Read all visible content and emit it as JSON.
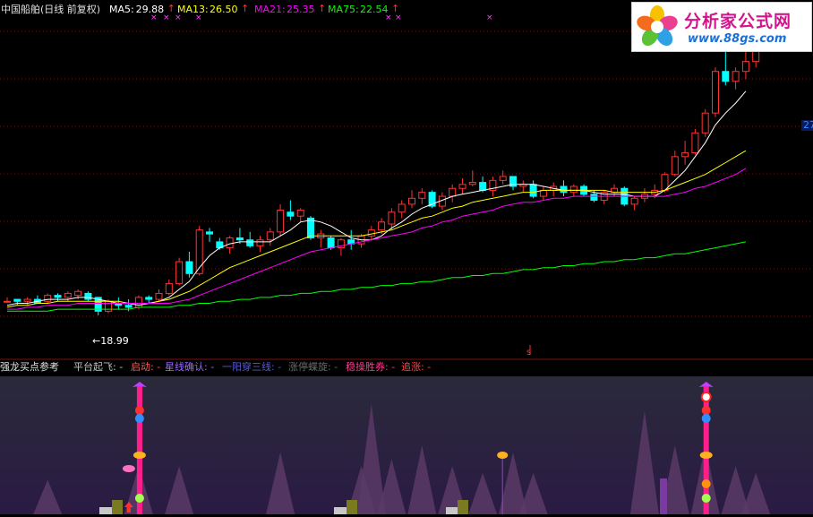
{
  "header": {
    "stock_name": "中国船舶(日线 前复权)",
    "ma": [
      {
        "label": "MA5:",
        "value": "29.88",
        "color": "#ffffff"
      },
      {
        "label": "MA13:",
        "value": "26.50",
        "color": "#ffff00"
      },
      {
        "label": "MA21:",
        "value": "25.35",
        "color": "#ff00ff"
      },
      {
        "label": "MA75:",
        "value": "22.54",
        "color": "#00ff00"
      }
    ],
    "arrow": "↑",
    "right_axis_label": "27",
    "low_marker": "18.99",
    "s_marker": "s"
  },
  "logo": {
    "title": "分析家公式网",
    "url": "www.88gs.com"
  },
  "indicator": {
    "title": "强龙买点参考",
    "signals": [
      {
        "label": "平台起飞:",
        "value": "-",
        "color": "#c0c0c0"
      },
      {
        "label": "启动:",
        "value": "-",
        "color": "#ff5a5a"
      },
      {
        "label": "星线确认:",
        "value": "-",
        "color": "#9a6bff"
      },
      {
        "label": "一阳穿三线:",
        "value": "-",
        "color": "#5a5ac8"
      },
      {
        "label": "涨停蝶旋:",
        "value": "-",
        "color": "#6a6a6a"
      },
      {
        "label": "稳操胜券:",
        "value": "-",
        "color": "#ff3c8c"
      },
      {
        "label": "追涨:",
        "value": "-",
        "color": "#ff4040"
      }
    ]
  },
  "colors": {
    "up": "#ff3232",
    "down": "#00ffff",
    "ma5": "#ffffff",
    "ma13": "#ffff00",
    "ma21": "#ff00ff",
    "ma75": "#00ff00",
    "grid": "#7a1010",
    "signal_bar": "#ff1e8c"
  },
  "chart_data": {
    "type": "candlestick",
    "title": "中国船舶(日线 前复权)",
    "ylim": [
      17.0,
      34.0
    ],
    "candles": [
      [
        19.7,
        19.9,
        19.6,
        19.7
      ],
      [
        19.8,
        19.8,
        19.5,
        19.7
      ],
      [
        19.7,
        19.9,
        19.5,
        19.8
      ],
      [
        19.8,
        20.0,
        19.6,
        19.6
      ],
      [
        19.7,
        20.1,
        19.6,
        20.0
      ],
      [
        20.0,
        20.1,
        19.7,
        19.9
      ],
      [
        19.9,
        20.2,
        19.7,
        20.1
      ],
      [
        20.0,
        20.3,
        19.8,
        20.2
      ],
      [
        20.1,
        20.2,
        19.7,
        19.8
      ],
      [
        19.9,
        19.9,
        18.99,
        19.2
      ],
      [
        19.2,
        19.8,
        19.1,
        19.7
      ],
      [
        19.6,
        19.9,
        19.3,
        19.5
      ],
      [
        19.5,
        19.8,
        19.2,
        19.4
      ],
      [
        19.4,
        20.0,
        19.3,
        19.9
      ],
      [
        19.9,
        20.0,
        19.6,
        19.8
      ],
      [
        19.8,
        20.3,
        19.7,
        20.1
      ],
      [
        20.1,
        20.8,
        20.0,
        20.6
      ],
      [
        20.6,
        21.9,
        20.5,
        21.7
      ],
      [
        21.7,
        22.2,
        20.9,
        21.1
      ],
      [
        21.1,
        23.5,
        21.0,
        23.3
      ],
      [
        23.2,
        23.4,
        22.7,
        23.1
      ],
      [
        22.7,
        22.9,
        22.3,
        22.4
      ],
      [
        22.4,
        23.0,
        22.1,
        22.9
      ],
      [
        22.9,
        23.4,
        22.6,
        22.8
      ],
      [
        22.8,
        23.2,
        22.4,
        22.5
      ],
      [
        22.5,
        23.0,
        22.2,
        22.8
      ],
      [
        22.8,
        23.4,
        22.5,
        23.2
      ],
      [
        23.2,
        24.6,
        23.0,
        24.3
      ],
      [
        24.2,
        24.8,
        23.8,
        24.0
      ],
      [
        24.0,
        24.4,
        23.7,
        24.3
      ],
      [
        23.9,
        24.0,
        22.8,
        22.9
      ],
      [
        22.9,
        23.3,
        22.4,
        23.1
      ],
      [
        22.9,
        23.0,
        22.3,
        22.4
      ],
      [
        22.4,
        22.9,
        22.0,
        22.8
      ],
      [
        22.8,
        23.3,
        22.3,
        22.6
      ],
      [
        22.6,
        23.1,
        22.4,
        23.0
      ],
      [
        23.0,
        23.5,
        22.8,
        23.3
      ],
      [
        23.3,
        23.9,
        23.1,
        23.7
      ],
      [
        23.6,
        24.4,
        23.3,
        24.2
      ],
      [
        24.2,
        24.8,
        23.9,
        24.6
      ],
      [
        24.6,
        25.3,
        24.4,
        24.9
      ],
      [
        24.9,
        25.4,
        24.6,
        25.2
      ],
      [
        25.2,
        25.3,
        24.4,
        24.5
      ],
      [
        24.5,
        25.2,
        24.3,
        25.0
      ],
      [
        25.0,
        25.6,
        24.7,
        25.4
      ],
      [
        25.4,
        25.9,
        25.1,
        25.6
      ],
      [
        25.6,
        26.3,
        25.5,
        25.7
      ],
      [
        25.7,
        26.0,
        25.2,
        25.3
      ],
      [
        25.3,
        26.0,
        25.0,
        25.8
      ],
      [
        25.8,
        26.3,
        25.6,
        26.0
      ],
      [
        26.0,
        26.0,
        25.3,
        25.5
      ],
      [
        25.5,
        25.8,
        25.2,
        25.6
      ],
      [
        25.6,
        25.8,
        24.9,
        25.0
      ],
      [
        25.0,
        25.5,
        24.8,
        25.3
      ],
      [
        25.3,
        25.7,
        25.0,
        25.5
      ],
      [
        25.5,
        25.8,
        25.0,
        25.2
      ],
      [
        25.2,
        25.6,
        25.0,
        25.5
      ],
      [
        25.5,
        25.6,
        25.0,
        25.1
      ],
      [
        25.1,
        25.3,
        24.7,
        24.8
      ],
      [
        24.8,
        25.3,
        24.6,
        25.2
      ],
      [
        25.2,
        25.6,
        25.0,
        25.4
      ],
      [
        25.4,
        25.5,
        24.5,
        24.6
      ],
      [
        24.6,
        25.0,
        24.3,
        24.9
      ],
      [
        24.9,
        25.4,
        24.7,
        25.1
      ],
      [
        25.1,
        25.6,
        24.9,
        25.3
      ],
      [
        25.3,
        26.2,
        25.2,
        26.1
      ],
      [
        26.1,
        27.3,
        26.0,
        27.0
      ],
      [
        27.0,
        27.8,
        26.6,
        27.2
      ],
      [
        27.2,
        28.4,
        27.1,
        28.2
      ],
      [
        28.2,
        29.4,
        28.0,
        29.2
      ],
      [
        29.2,
        31.5,
        29.0,
        31.3
      ],
      [
        31.3,
        32.6,
        30.6,
        30.8
      ],
      [
        30.8,
        31.5,
        30.4,
        31.3
      ],
      [
        31.3,
        32.3,
        30.9,
        31.8
      ],
      [
        31.8,
        33.5,
        31.5,
        33.3
      ]
    ],
    "series": [
      {
        "name": "MA5",
        "values": [
          19.5,
          19.6,
          19.6,
          19.7,
          19.8,
          19.8,
          19.8,
          19.9,
          19.9,
          19.8,
          19.7,
          19.6,
          19.6,
          19.5,
          19.6,
          19.7,
          19.9,
          20.3,
          20.7,
          21.4,
          22.0,
          22.4,
          22.6,
          22.7,
          22.7,
          22.7,
          22.7,
          23.0,
          23.3,
          23.7,
          23.8,
          23.7,
          23.5,
          23.2,
          22.9,
          22.8,
          22.8,
          23.0,
          23.4,
          23.7,
          24.1,
          24.4,
          24.6,
          24.8,
          25.0,
          25.1,
          25.2,
          25.3,
          25.4,
          25.5,
          25.6,
          25.6,
          25.6,
          25.5,
          25.4,
          25.3,
          25.3,
          25.3,
          25.2,
          25.1,
          25.1,
          25.1,
          25.0,
          25.0,
          25.0,
          25.3,
          25.8,
          26.3,
          27.0,
          27.7,
          28.6,
          29.2,
          29.7,
          30.3,
          29.88
        ]
      },
      {
        "name": "MA13",
        "values": [
          19.4,
          19.5,
          19.5,
          19.6,
          19.6,
          19.7,
          19.7,
          19.7,
          19.7,
          19.7,
          19.7,
          19.7,
          19.6,
          19.6,
          19.6,
          19.7,
          19.8,
          20.0,
          20.2,
          20.5,
          20.8,
          21.1,
          21.4,
          21.6,
          21.8,
          22.0,
          22.2,
          22.4,
          22.6,
          22.8,
          23.0,
          23.0,
          23.0,
          23.0,
          23.0,
          23.0,
          23.1,
          23.2,
          23.3,
          23.5,
          23.7,
          23.9,
          24.0,
          24.2,
          24.4,
          24.5,
          24.7,
          24.8,
          24.9,
          25.0,
          25.1,
          25.2,
          25.2,
          25.3,
          25.3,
          25.3,
          25.3,
          25.3,
          25.3,
          25.3,
          25.2,
          25.2,
          25.2,
          25.2,
          25.2,
          25.3,
          25.5,
          25.7,
          25.9,
          26.1,
          26.4,
          26.7,
          27.0,
          27.3,
          26.5
        ]
      },
      {
        "name": "MA21",
        "values": [
          19.3,
          19.3,
          19.4,
          19.4,
          19.5,
          19.5,
          19.5,
          19.6,
          19.6,
          19.6,
          19.6,
          19.6,
          19.6,
          19.6,
          19.6,
          19.6,
          19.6,
          19.7,
          19.8,
          20.0,
          20.2,
          20.4,
          20.6,
          20.8,
          21.0,
          21.2,
          21.4,
          21.6,
          21.8,
          22.0,
          22.2,
          22.3,
          22.4,
          22.5,
          22.6,
          22.7,
          22.8,
          22.9,
          23.0,
          23.1,
          23.2,
          23.4,
          23.5,
          23.7,
          23.8,
          24.0,
          24.1,
          24.2,
          24.3,
          24.5,
          24.6,
          24.7,
          24.7,
          24.8,
          24.9,
          24.9,
          25.0,
          25.0,
          25.0,
          25.0,
          25.0,
          25.0,
          25.0,
          25.0,
          25.0,
          25.0,
          25.1,
          25.2,
          25.4,
          25.5,
          25.7,
          25.9,
          26.1,
          26.4,
          25.35
        ]
      },
      {
        "name": "MA75",
        "values": [
          19.2,
          19.2,
          19.2,
          19.2,
          19.2,
          19.3,
          19.3,
          19.3,
          19.3,
          19.3,
          19.3,
          19.3,
          19.3,
          19.4,
          19.4,
          19.4,
          19.4,
          19.5,
          19.5,
          19.6,
          19.6,
          19.7,
          19.7,
          19.8,
          19.8,
          19.9,
          19.9,
          20.0,
          20.0,
          20.1,
          20.1,
          20.2,
          20.2,
          20.3,
          20.3,
          20.4,
          20.4,
          20.5,
          20.5,
          20.6,
          20.6,
          20.7,
          20.7,
          20.8,
          20.9,
          20.9,
          21.0,
          21.0,
          21.1,
          21.1,
          21.2,
          21.3,
          21.3,
          21.4,
          21.4,
          21.5,
          21.5,
          21.6,
          21.6,
          21.7,
          21.7,
          21.8,
          21.8,
          21.9,
          21.9,
          22.0,
          22.1,
          22.1,
          22.2,
          22.3,
          22.4,
          22.5,
          22.6,
          22.7,
          22.54
        ]
      }
    ],
    "indicator": {
      "signal_days": [
        13,
        69
      ],
      "purple_line_day": 49,
      "mountains": [
        [
          4,
          0.25
        ],
        [
          13,
          0.35
        ],
        [
          17,
          0.35
        ],
        [
          27,
          0.45
        ],
        [
          35,
          0.35
        ],
        [
          36,
          0.8
        ],
        [
          38,
          0.4
        ],
        [
          41,
          0.5
        ],
        [
          44,
          0.35
        ],
        [
          47,
          0.3
        ],
        [
          50,
          0.45
        ],
        [
          52,
          0.3
        ],
        [
          63,
          0.75
        ],
        [
          66,
          0.5
        ],
        [
          69,
          0.5
        ],
        [
          72,
          0.35
        ],
        [
          74,
          0.3
        ]
      ]
    }
  }
}
